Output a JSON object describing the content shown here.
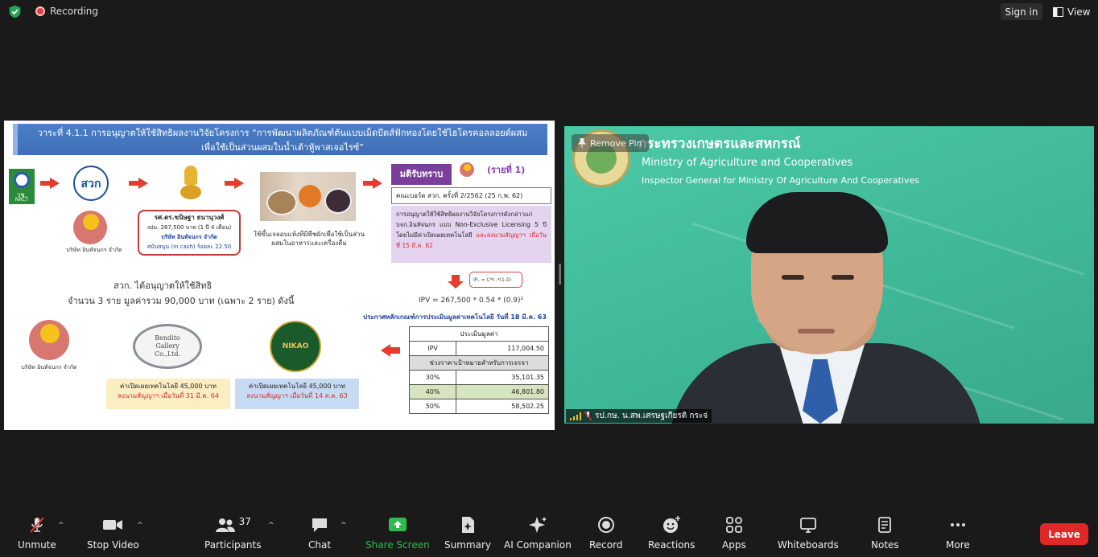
{
  "topbar": {
    "recording": "Recording",
    "sign_in": "Sign in",
    "view": "View"
  },
  "slide": {
    "title_line1": "วาระที่ 4.1.1 การอนุญาตให้ใช้สิทธิผลงานวิจัยโครงการ “การพัฒนาผลิตภัณฑ์ต้นแบบเม็ดบีดส์ฟักทองโดยใช้ไฮโดรคอลลอยด์ผสม",
    "title_line2": "เพื่อใช้เป็นส่วนผสมในน้ำเต้าหู้พาสเจอไรซ์”",
    "nrct_label": "วช.",
    "nrct_sub": "NRCT",
    "company_left": "บริษัท อินทัจนกร จำกัด",
    "researcher_name": "รศ.ดร.ขนิษฐา ธนานุวงศ์",
    "researcher_budget": "งปม. 267,500 บาท (1 ปี 4 เดือน)",
    "researcher_company": "บริษัท อินทัจนกร จำกัด",
    "researcher_support": "สนับสนุน (in cash) ร้อยละ 22.50",
    "product_desc": "ใช้ขึ้นเจลอบแห้งที่มีพืชผักเพื่อใช้เป็นส่วนผสมในอาหารและเครื่องดื่ม",
    "resolution_label": "มติรับทราบ",
    "item_no": "(รายที่ 1)",
    "committee": "คณะบอร์ด สวก. ครั้งที่ 2/2562 (25 ก.พ. 62)",
    "license_text_1": "การอนุญาตให้ใช้สิทธิผลงานวิจัยโครงการดังกล่าวแก่ บจก.อินทัจนกร แบบ Non-Exclusive Licensing 5 ปี โดยไม่มีค่าเปิดเผยเทคโนโลยี",
    "license_text_2": "และลงนามสัญญาฯ เมื่อวันที่ 15 มี.ค. 62",
    "ipv_formula_small": "IPᵥ = C*r..*(1-δ)",
    "ipv_formula": "IPV = 267,500 * 0.54 * (0.9)²",
    "announce": "ประกาศหลักเกณฑ์การประเมินมูลค่าเทคโนโลยี วันที่ 18 มี.ค. 63",
    "licensed_line1": "สวก. ได้อนุญาตให้ใช้สิทธิ",
    "licensed_line2": "จำนวน 3 ราย มูลค่ารวม 90,000 บาท (เฉพาะ 2 ราย) ดังนี้",
    "company_bottom": "บริษัท อินทัจนกร จำกัด",
    "bendito_logo": "Bendito Gallery Co.,Ltd.",
    "nikao_logo": "NIKAO",
    "fee1_line1": "ค่าเปิดเผยเทคโนโลยี 45,000 บาท",
    "fee1_line2": "ลงนามสัญญาฯ เมื่อวันที่ 31 มี.ค. 64",
    "fee2_line1": "ค่าเปิดเผยเทคโนโลยี 45,000 บาท",
    "fee2_line2": "ลงนามสัญญาฯ เมื่อวันที่ 14 ส.ค. 63",
    "table": {
      "header": "ประเมินมูลค่า",
      "ipv_label": "IPV",
      "ipv_value": "117,004.50",
      "range_header": "ช่วงราคาเป้าหมายสำหรับการเจรจา",
      "rows": [
        {
          "pct": "30%",
          "value": "35,101.35"
        },
        {
          "pct": "40%",
          "value": "46,801.80"
        },
        {
          "pct": "50%",
          "value": "58,502.25"
        }
      ]
    }
  },
  "video": {
    "ministry_th": "กระทรวงเกษตรและสหกรณ์",
    "ministry_en": "Ministry of Agriculture and Cooperatives",
    "inspector": "Inspector General for Ministry Of Agriculture And Cooperatives",
    "remove_pin": "Remove Pin",
    "participant_name": "รป.กษ. น.สพ.เศรษฐเกียรติ กระจ่"
  },
  "toolbar": {
    "unmute": "Unmute",
    "stop_video": "Stop Video",
    "participants": "Participants",
    "participants_count": "37",
    "chat": "Chat",
    "share_screen": "Share Screen",
    "summary": "Summary",
    "ai_companion": "AI Companion",
    "record": "Record",
    "reactions": "Reactions",
    "apps": "Apps",
    "whiteboards": "Whiteboards",
    "notes": "Notes",
    "more": "More",
    "leave": "Leave"
  },
  "colors": {
    "share_green": "#2dbb4e",
    "leave_red": "#e02828",
    "recording_red": "#e43e3e"
  }
}
